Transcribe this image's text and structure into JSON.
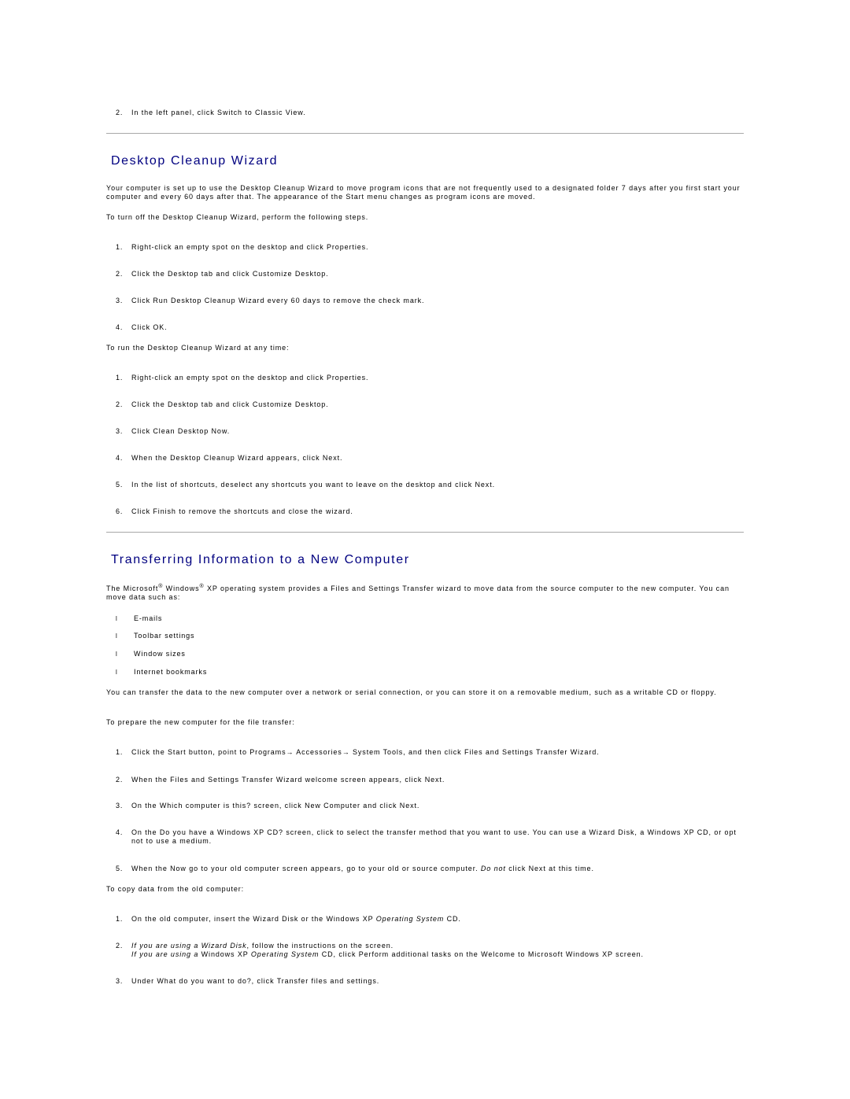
{
  "top_step": {
    "num": "2.",
    "text": "In the left panel, click Switch to Classic View."
  },
  "section1": {
    "title": "Desktop Cleanup Wizard",
    "intro": "Your computer is set up to use the Desktop Cleanup Wizard to move program icons that are not frequently used to a designated folder 7 days after you first start your computer and every 60 days after that. The appearance of the Start menu changes as program icons are moved.",
    "turn_off_lead": "To turn off the Desktop Cleanup Wizard, perform the following steps.",
    "turn_off_steps": [
      {
        "num": "1.",
        "text": "Right-click an empty spot on the desktop and click Properties."
      },
      {
        "num": "2.",
        "text": "Click the Desktop tab and click Customize Desktop."
      },
      {
        "num": "3.",
        "text": "Click Run Desktop Cleanup Wizard every 60 days to remove the check mark."
      },
      {
        "num": "4.",
        "text": "Click OK."
      }
    ],
    "run_lead": "To run the Desktop Cleanup Wizard at any time:",
    "run_steps": [
      {
        "num": "1.",
        "text": "Right-click an empty spot on the desktop and click Properties."
      },
      {
        "num": "2.",
        "text": "Click the Desktop tab and click Customize Desktop."
      },
      {
        "num": "3.",
        "text": "Click Clean Desktop Now."
      },
      {
        "num": "4.",
        "text": "When the Desktop Cleanup Wizard appears, click Next."
      },
      {
        "num": "5.",
        "text": "In the list of shortcuts, deselect any shortcuts you want to leave on the desktop and click Next."
      },
      {
        "num": "6.",
        "text": "Click Finish to remove the shortcuts and close the wizard."
      }
    ]
  },
  "section2": {
    "title": "Transferring Information to a New Computer",
    "intro_part1": "The Microsoft",
    "intro_reg1": "®",
    "intro_part2": " Windows",
    "intro_reg2": "®",
    "intro_part3": " XP operating system provides a Files and Settings Transfer wizard to move data from the source computer to the new computer. You can move data such as:",
    "bullet_glyph": "l",
    "bullets": [
      "E-mails",
      "Toolbar settings",
      "Window sizes",
      "Internet bookmarks"
    ],
    "transfer_para": "You can transfer the data to the new computer over a network or serial connection, or you can store it on a removable medium, such as a writable CD or floppy.",
    "prepare_lead": "To prepare the new computer for the file transfer:",
    "prepare_steps": [
      {
        "num": "1.",
        "text": "Click the Start button, point to Programs→ Accessories→ System Tools, and then click Files and Settings Transfer Wizard."
      },
      {
        "num": "2.",
        "text": "When the Files and Settings Transfer Wizard welcome screen appears, click Next."
      },
      {
        "num": "3.",
        "text": "On the Which computer is this? screen, click New Computer and click Next."
      },
      {
        "num": "4.",
        "text": "On the Do you have a Windows XP CD? screen, click to select the transfer method that you want to use. You can use a Wizard Disk, a Windows XP CD, or opt not to use a medium."
      },
      {
        "num": "5.",
        "pre": "When the Now go to your old computer screen appears, go to your old or source computer. ",
        "em": "Do not",
        "post": " click Next at this time."
      }
    ],
    "copy_lead": "To copy data from the old computer:",
    "copy_steps": [
      {
        "num": "1.",
        "pre": "On the old computer, insert the Wizard Disk or the Windows XP ",
        "em": "Operating System",
        "post": " CD."
      },
      {
        "num": "2.",
        "line1_em": "If you are using a Wizard Disk",
        "line1_post": ", follow the instructions on the screen.",
        "line2_em1": "If you are using a",
        "line2_mid": " Windows XP ",
        "line2_em2": "Operating System",
        "line2_post": " CD, click Perform additional tasks on the Welcome to Microsoft Windows XP screen."
      },
      {
        "num": "3.",
        "text": "Under What do you want to do?, click Transfer files and settings."
      }
    ]
  }
}
